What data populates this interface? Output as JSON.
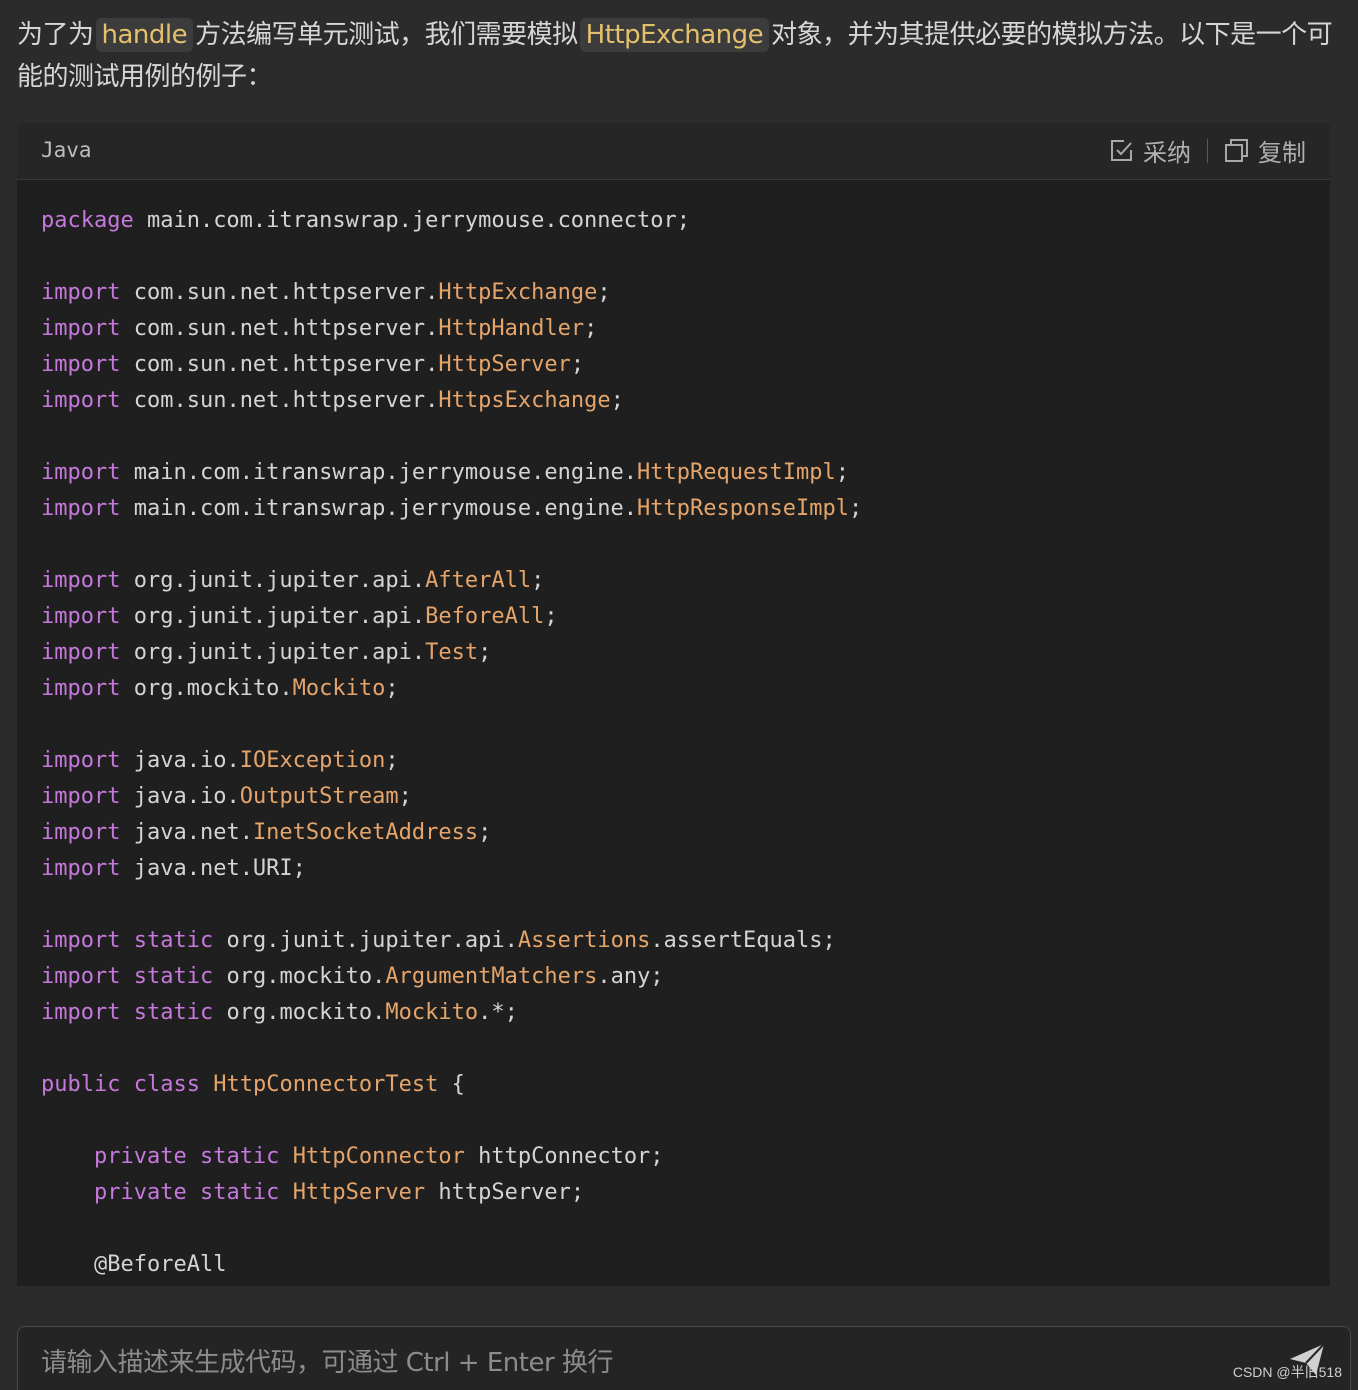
{
  "intro": {
    "part1": "为了为",
    "code1": "handle",
    "part2": "方法编写单元测试，我们需要模拟",
    "code2": "HttpExchange",
    "part3": "对象，并为其提供必要的模拟方法。以下是一个可能的测试用例的例子："
  },
  "code_block": {
    "language": "Java",
    "adopt_label": "采纳",
    "copy_label": "复制",
    "lines": [
      [
        [
          "kw",
          "package"
        ],
        [
          "plain",
          " main.com.itranswrap.jerrymouse.connector;"
        ]
      ],
      [],
      [
        [
          "kw",
          "import"
        ],
        [
          "plain",
          " com.sun.net.httpserver."
        ],
        [
          "type",
          "HttpExchange"
        ],
        [
          "plain",
          ";"
        ]
      ],
      [
        [
          "kw",
          "import"
        ],
        [
          "plain",
          " com.sun.net.httpserver."
        ],
        [
          "type",
          "HttpHandler"
        ],
        [
          "plain",
          ";"
        ]
      ],
      [
        [
          "kw",
          "import"
        ],
        [
          "plain",
          " com.sun.net.httpserver."
        ],
        [
          "type",
          "HttpServer"
        ],
        [
          "plain",
          ";"
        ]
      ],
      [
        [
          "kw",
          "import"
        ],
        [
          "plain",
          " com.sun.net.httpserver."
        ],
        [
          "type",
          "HttpsExchange"
        ],
        [
          "plain",
          ";"
        ]
      ],
      [],
      [
        [
          "kw",
          "import"
        ],
        [
          "plain",
          " main.com.itranswrap.jerrymouse.engine."
        ],
        [
          "type",
          "HttpRequestImpl"
        ],
        [
          "plain",
          ";"
        ]
      ],
      [
        [
          "kw",
          "import"
        ],
        [
          "plain",
          " main.com.itranswrap.jerrymouse.engine."
        ],
        [
          "type",
          "HttpResponseImpl"
        ],
        [
          "plain",
          ";"
        ]
      ],
      [],
      [
        [
          "kw",
          "import"
        ],
        [
          "plain",
          " org.junit.jupiter.api."
        ],
        [
          "type",
          "AfterAll"
        ],
        [
          "plain",
          ";"
        ]
      ],
      [
        [
          "kw",
          "import"
        ],
        [
          "plain",
          " org.junit.jupiter.api."
        ],
        [
          "type",
          "BeforeAll"
        ],
        [
          "plain",
          ";"
        ]
      ],
      [
        [
          "kw",
          "import"
        ],
        [
          "plain",
          " org.junit.jupiter.api."
        ],
        [
          "type",
          "Test"
        ],
        [
          "plain",
          ";"
        ]
      ],
      [
        [
          "kw",
          "import"
        ],
        [
          "plain",
          " org.mockito."
        ],
        [
          "type",
          "Mockito"
        ],
        [
          "plain",
          ";"
        ]
      ],
      [],
      [
        [
          "kw",
          "import"
        ],
        [
          "plain",
          " java.io."
        ],
        [
          "type",
          "IOException"
        ],
        [
          "plain",
          ";"
        ]
      ],
      [
        [
          "kw",
          "import"
        ],
        [
          "plain",
          " java.io."
        ],
        [
          "type",
          "OutputStream"
        ],
        [
          "plain",
          ";"
        ]
      ],
      [
        [
          "kw",
          "import"
        ],
        [
          "plain",
          " java.net."
        ],
        [
          "type",
          "InetSocketAddress"
        ],
        [
          "plain",
          ";"
        ]
      ],
      [
        [
          "kw",
          "import"
        ],
        [
          "plain",
          " java.net.URI;"
        ]
      ],
      [],
      [
        [
          "kw",
          "import"
        ],
        [
          "plain",
          " "
        ],
        [
          "kw",
          "static"
        ],
        [
          "plain",
          " org.junit.jupiter.api."
        ],
        [
          "type",
          "Assertions"
        ],
        [
          "plain",
          ".assertEquals;"
        ]
      ],
      [
        [
          "kw",
          "import"
        ],
        [
          "plain",
          " "
        ],
        [
          "kw",
          "static"
        ],
        [
          "plain",
          " org.mockito."
        ],
        [
          "type",
          "ArgumentMatchers"
        ],
        [
          "plain",
          ".any;"
        ]
      ],
      [
        [
          "kw",
          "import"
        ],
        [
          "plain",
          " "
        ],
        [
          "kw",
          "static"
        ],
        [
          "plain",
          " org.mockito."
        ],
        [
          "type",
          "Mockito"
        ],
        [
          "plain",
          ".*;"
        ]
      ],
      [],
      [
        [
          "kw",
          "public"
        ],
        [
          "plain",
          " "
        ],
        [
          "kw",
          "class"
        ],
        [
          "plain",
          " "
        ],
        [
          "type",
          "HttpConnectorTest"
        ],
        [
          "plain",
          " {"
        ]
      ],
      [],
      [
        [
          "plain",
          "    "
        ],
        [
          "kw",
          "private"
        ],
        [
          "plain",
          " "
        ],
        [
          "kw",
          "static"
        ],
        [
          "plain",
          " "
        ],
        [
          "type",
          "HttpConnector"
        ],
        [
          "plain",
          " httpConnector;"
        ]
      ],
      [
        [
          "plain",
          "    "
        ],
        [
          "kw",
          "private"
        ],
        [
          "plain",
          " "
        ],
        [
          "kw",
          "static"
        ],
        [
          "plain",
          " "
        ],
        [
          "type",
          "HttpServer"
        ],
        [
          "plain",
          " httpServer;"
        ]
      ],
      [],
      [
        [
          "plain",
          "    "
        ],
        [
          "ann",
          "@BeforeAll"
        ]
      ]
    ]
  },
  "prompt": {
    "placeholder": "请输入描述来生成代码，可通过 Ctrl + Enter 换行"
  },
  "watermark": "CSDN @半旧518",
  "colors": {
    "keyword": "#c678dd",
    "type": "#e5a46a",
    "text": "#d4d4d4",
    "background": "#1f1f1f"
  }
}
